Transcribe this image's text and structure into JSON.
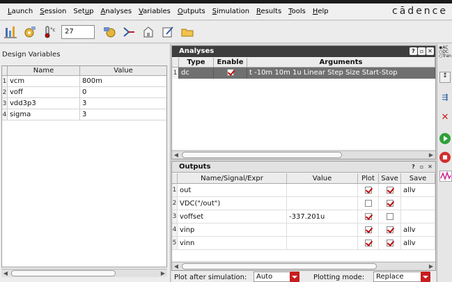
{
  "menubar": {
    "items": [
      {
        "pre": "",
        "ul": "L",
        "post": "aunch"
      },
      {
        "pre": "",
        "ul": "S",
        "post": "ession"
      },
      {
        "pre": "Set",
        "ul": "u",
        "post": "p"
      },
      {
        "pre": "",
        "ul": "A",
        "post": "nalyses"
      },
      {
        "pre": "",
        "ul": "V",
        "post": "ariables"
      },
      {
        "pre": "",
        "ul": "O",
        "post": "utputs"
      },
      {
        "pre": "",
        "ul": "S",
        "post": "imulation"
      },
      {
        "pre": "",
        "ul": "R",
        "post": "esults"
      },
      {
        "pre": "",
        "ul": "T",
        "post": "ools"
      },
      {
        "pre": "",
        "ul": "H",
        "post": "elp"
      }
    ],
    "brand": "cādence"
  },
  "toolbar": {
    "temperature": "27",
    "temp_unit": "°c"
  },
  "design_variables": {
    "title": "Design Variables",
    "col_name": "Name",
    "col_value": "Value",
    "rows": [
      {
        "n": "1",
        "name": "vcm",
        "value": "800m"
      },
      {
        "n": "2",
        "name": "voff",
        "value": "0"
      },
      {
        "n": "3",
        "name": "vdd3p3",
        "value": "3"
      },
      {
        "n": "4",
        "name": "sigma",
        "value": "3"
      }
    ]
  },
  "analyses": {
    "title": "Analyses",
    "col_type": "Type",
    "col_enable": "Enable",
    "col_args": "Arguments",
    "rows": [
      {
        "n": "1",
        "type": "dc",
        "enabled": true,
        "args": "t -10m 10m 1u Linear Step Size Start-Stop"
      }
    ]
  },
  "outputs": {
    "title": "Outputs",
    "col_name": "Name/Signal/Expr",
    "col_value": "Value",
    "col_plot": "Plot",
    "col_save": "Save",
    "col_saveopt": "Save",
    "rows": [
      {
        "n": "1",
        "name": "out",
        "value": "",
        "plot": true,
        "save": true,
        "saveopt": "allv"
      },
      {
        "n": "2",
        "name": "VDC(\"/out\")",
        "value": "",
        "plot": false,
        "save": true,
        "saveopt": ""
      },
      {
        "n": "3",
        "name": "voffset",
        "value": "-337.201u",
        "plot": true,
        "save": false,
        "saveopt": ""
      },
      {
        "n": "4",
        "name": "vinp",
        "value": "",
        "plot": true,
        "save": true,
        "saveopt": "allv"
      },
      {
        "n": "5",
        "name": "vinn",
        "value": "",
        "plot": true,
        "save": true,
        "saveopt": "allv"
      }
    ]
  },
  "bottom": {
    "plot_after_label": "Plot after simulation:",
    "plot_after_value": "Auto",
    "plotting_mode_label": "Plotting mode:",
    "plotting_mode_value": "Replace"
  },
  "right_strip": {
    "analysis_labels": [
      "AC",
      "DC",
      "Tran"
    ]
  }
}
